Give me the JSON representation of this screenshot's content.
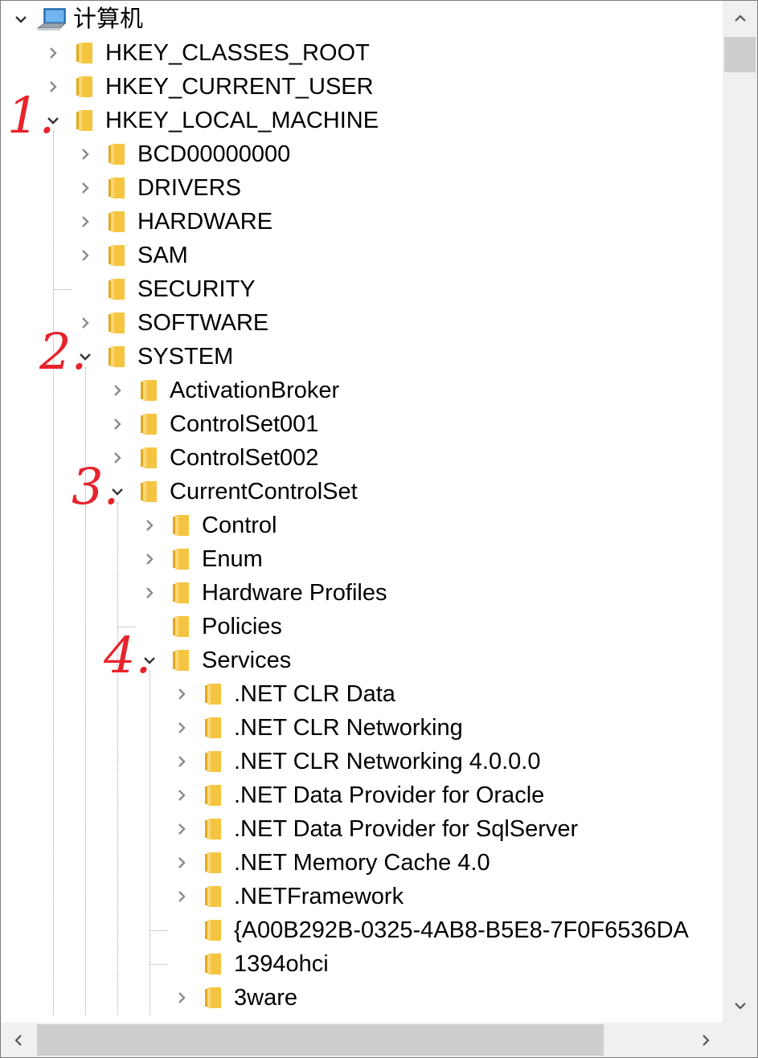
{
  "tree": {
    "root": {
      "label": "计算机",
      "icon": "computer-icon",
      "state": "expanded"
    },
    "nodes": [
      {
        "label": "HKEY_CLASSES_ROOT",
        "level": 1,
        "state": "collapsed"
      },
      {
        "label": "HKEY_CURRENT_USER",
        "level": 1,
        "state": "collapsed"
      },
      {
        "label": "HKEY_LOCAL_MACHINE",
        "level": 1,
        "state": "expanded"
      },
      {
        "label": "BCD00000000",
        "level": 2,
        "state": "collapsed"
      },
      {
        "label": "DRIVERS",
        "level": 2,
        "state": "collapsed"
      },
      {
        "label": "HARDWARE",
        "level": 2,
        "state": "collapsed"
      },
      {
        "label": "SAM",
        "level": 2,
        "state": "collapsed"
      },
      {
        "label": "SECURITY",
        "level": 2,
        "state": "leaf"
      },
      {
        "label": "SOFTWARE",
        "level": 2,
        "state": "collapsed"
      },
      {
        "label": "SYSTEM",
        "level": 2,
        "state": "expanded"
      },
      {
        "label": "ActivationBroker",
        "level": 3,
        "state": "collapsed"
      },
      {
        "label": "ControlSet001",
        "level": 3,
        "state": "collapsed"
      },
      {
        "label": "ControlSet002",
        "level": 3,
        "state": "collapsed"
      },
      {
        "label": "CurrentControlSet",
        "level": 3,
        "state": "expanded"
      },
      {
        "label": "Control",
        "level": 4,
        "state": "collapsed"
      },
      {
        "label": "Enum",
        "level": 4,
        "state": "collapsed"
      },
      {
        "label": "Hardware Profiles",
        "level": 4,
        "state": "collapsed"
      },
      {
        "label": "Policies",
        "level": 4,
        "state": "leaf"
      },
      {
        "label": "Services",
        "level": 4,
        "state": "expanded"
      },
      {
        "label": ".NET CLR Data",
        "level": 5,
        "state": "collapsed"
      },
      {
        "label": ".NET CLR Networking",
        "level": 5,
        "state": "collapsed"
      },
      {
        "label": ".NET CLR Networking 4.0.0.0",
        "level": 5,
        "state": "collapsed"
      },
      {
        "label": ".NET Data Provider for Oracle",
        "level": 5,
        "state": "collapsed"
      },
      {
        "label": ".NET Data Provider for SqlServer",
        "level": 5,
        "state": "collapsed"
      },
      {
        "label": ".NET Memory Cache 4.0",
        "level": 5,
        "state": "collapsed"
      },
      {
        "label": ".NETFramework",
        "level": 5,
        "state": "collapsed"
      },
      {
        "label": "{A00B292B-0325-4AB8-B5E8-7F0F6536DA",
        "level": 5,
        "state": "leaf"
      },
      {
        "label": "1394ohci",
        "level": 5,
        "state": "leaf"
      },
      {
        "label": "3ware",
        "level": 5,
        "state": "collapsed"
      }
    ]
  },
  "annotations": [
    {
      "text": "1.",
      "node": "HKEY_LOCAL_MACHINE"
    },
    {
      "text": "2.",
      "node": "SYSTEM"
    },
    {
      "text": "3.",
      "node": "CurrentControlSet"
    },
    {
      "text": "4.",
      "node": "Services"
    }
  ],
  "colors": {
    "annotation": "#e8232b",
    "folder": "#f5c542",
    "arrow": "#6b6b6b",
    "scroll_track": "#f0f0f0",
    "scroll_thumb": "#cdcdcd"
  },
  "scrollbars": {
    "vertical": {
      "position_fraction": 0.0
    },
    "horizontal": {
      "position_fraction": 0.0
    }
  }
}
